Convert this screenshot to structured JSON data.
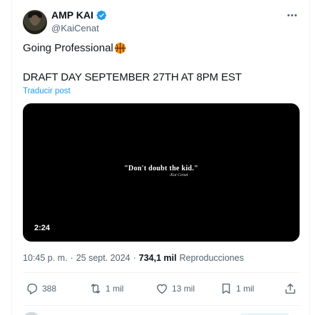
{
  "author": {
    "display_name": "AMP KAI",
    "handle": "@KaiCenat",
    "verified": true,
    "avatar_icon": "avatar"
  },
  "tweet": {
    "line1": "Going Professional",
    "line1_emoji": "basketball-icon",
    "line2": "DRAFT DAY SEPTEMBER 27TH AT 8PM EST",
    "translate_label": "Traducir post"
  },
  "video": {
    "quote": "\"Don't doubt the kid.\"",
    "attribution": "-Kai Cenat",
    "duration": "2:24"
  },
  "meta": {
    "time": "10:45 p. m.",
    "separator": "·",
    "date": "25 sept. 2024",
    "views_count": "734,1 mil",
    "views_label": "Reproducciones"
  },
  "actions": {
    "replies": "388",
    "retweets": "1 mil",
    "likes": "13 mil",
    "bookmarks": "1 mil"
  },
  "colors": {
    "accent": "#1d9bf0",
    "text_primary": "#0f1419",
    "text_secondary": "#536471",
    "divider": "#eff3f4"
  }
}
